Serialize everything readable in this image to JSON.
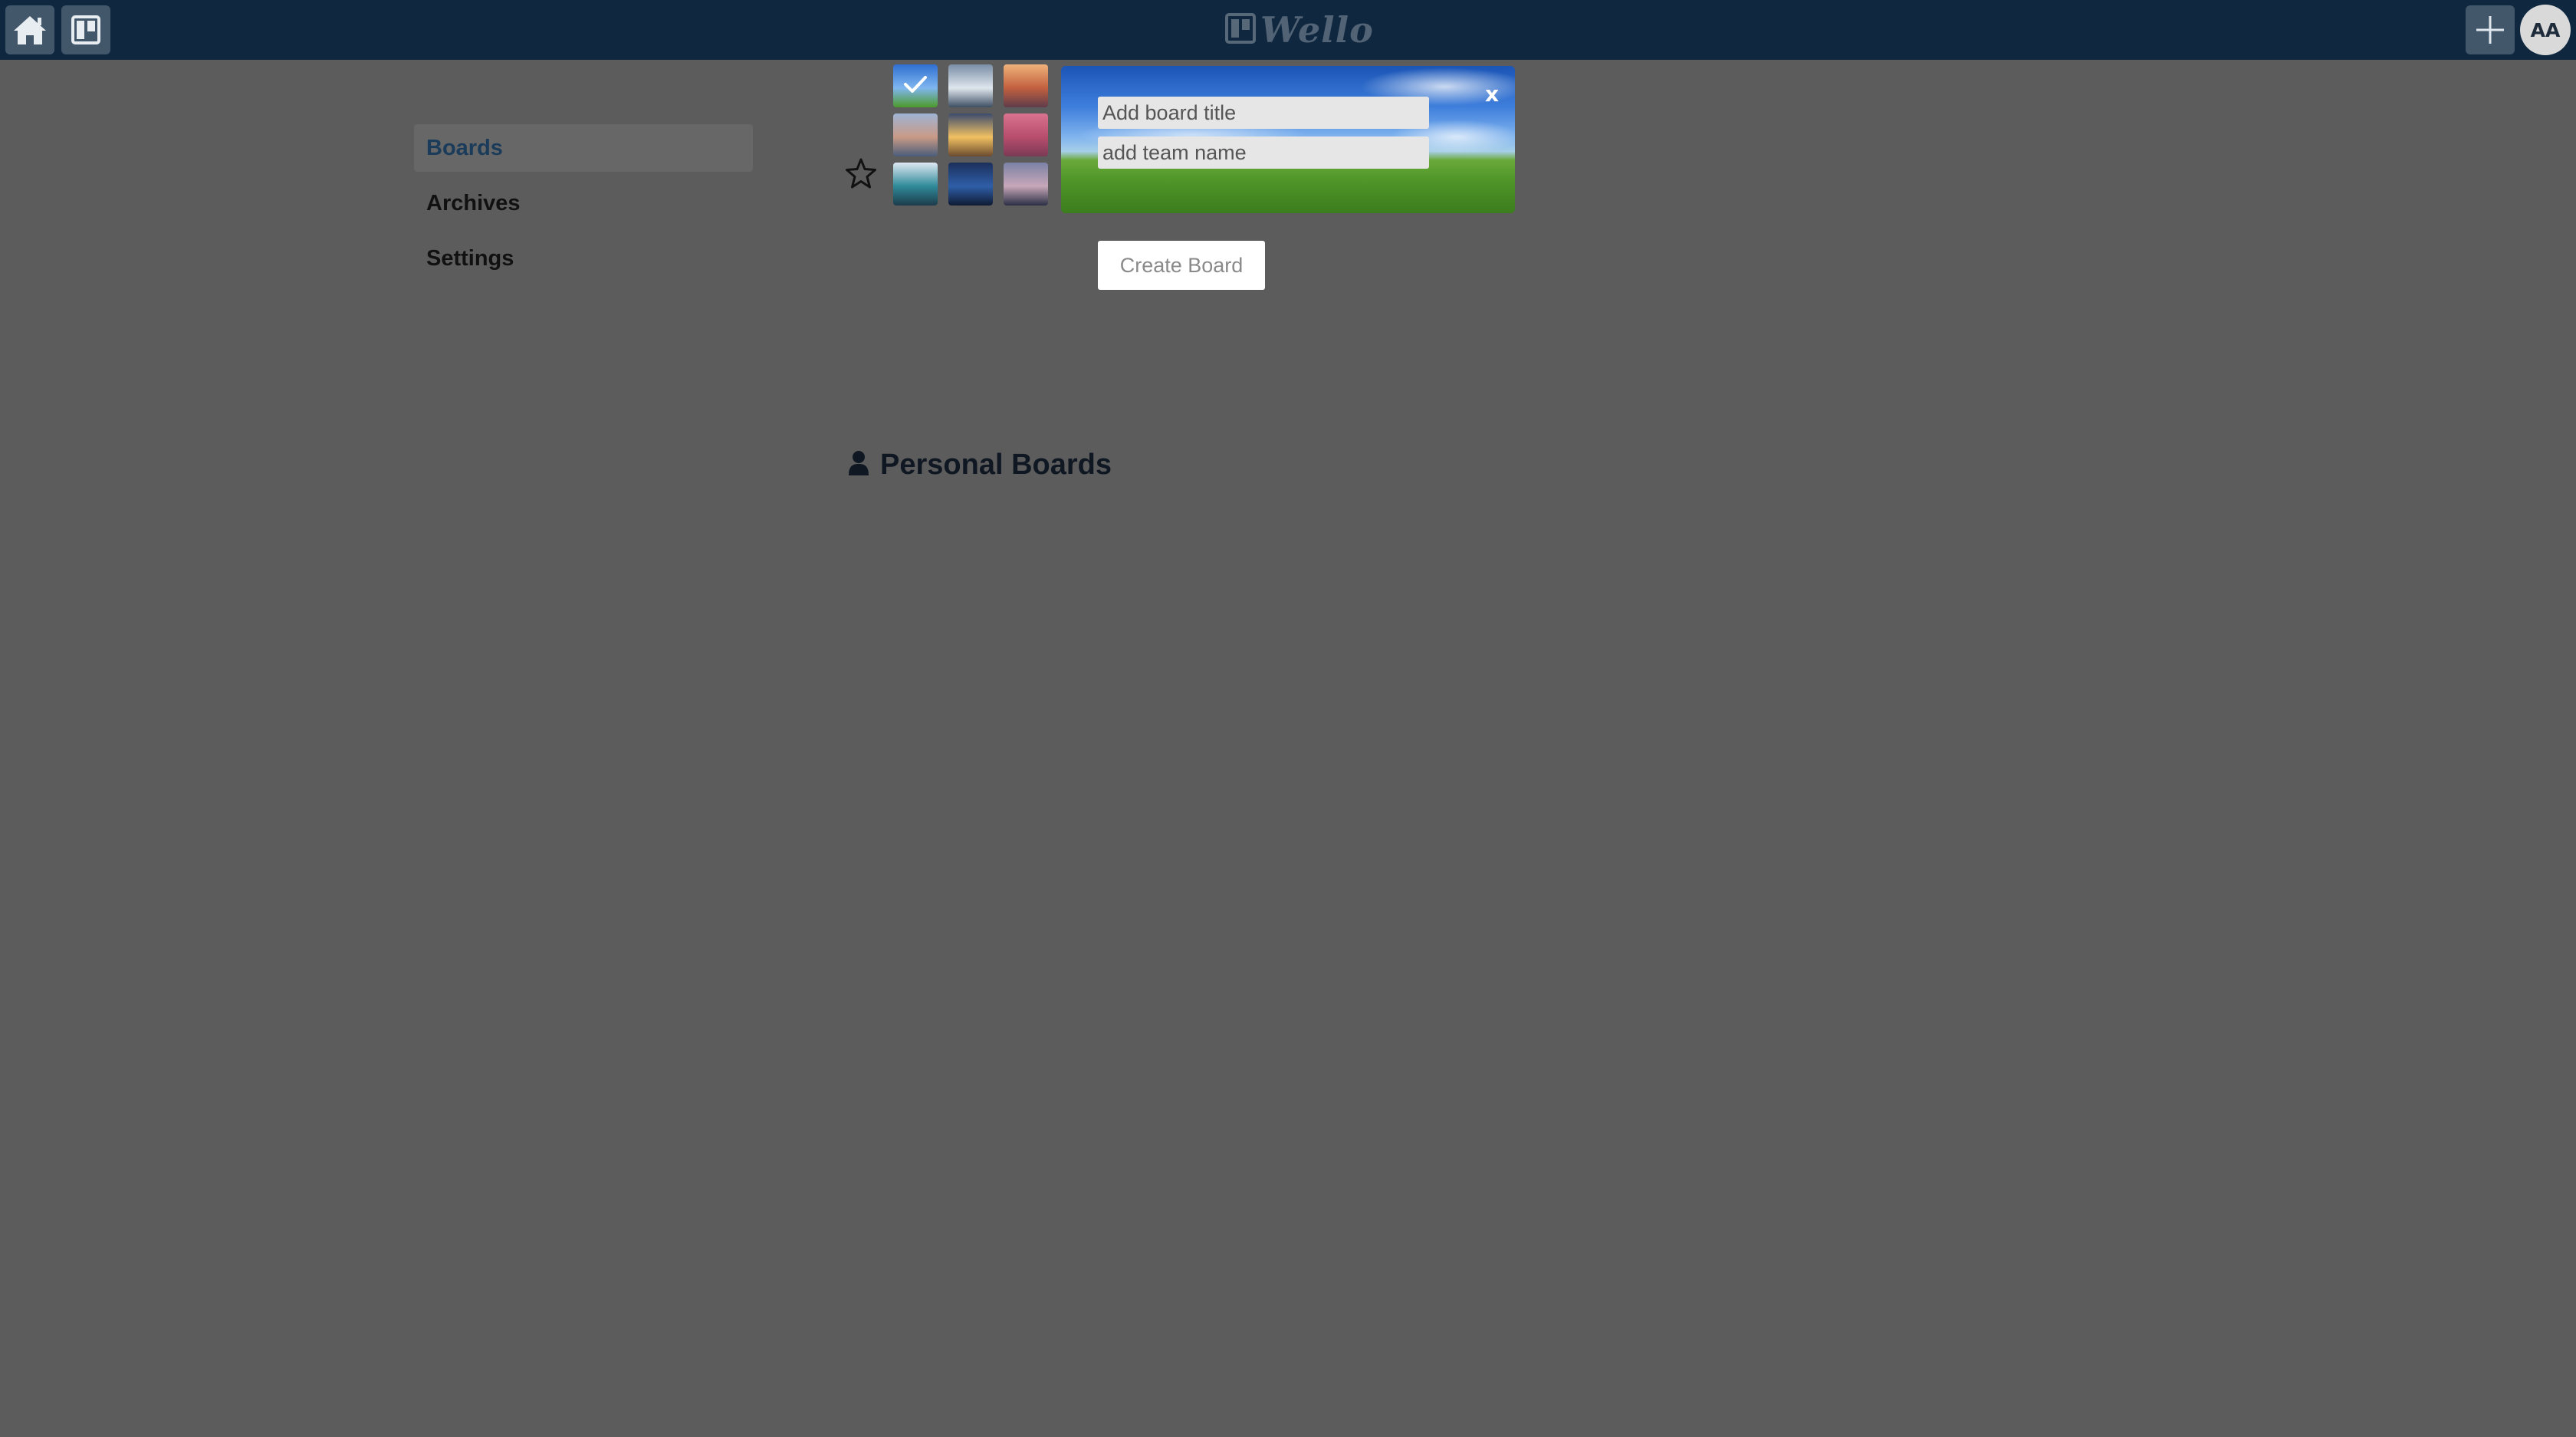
{
  "app": {
    "logo_text": "Wello"
  },
  "topbar": {
    "home_icon": "home-icon",
    "boards_icon": "boards-icon",
    "add_icon": "plus-icon",
    "avatar_initials": "AA"
  },
  "sidebar": {
    "items": [
      {
        "label": "Boards",
        "active": true
      },
      {
        "label": "Archives",
        "active": false
      },
      {
        "label": "Settings",
        "active": false
      }
    ]
  },
  "composer": {
    "title_placeholder": "Add board title",
    "title_value": "",
    "team_placeholder": "add team name",
    "team_value": "",
    "close_label": "x",
    "create_label": "Create Board",
    "star_icon": "star-outline-icon",
    "selected_background": 0,
    "backgrounds": [
      {
        "name": "green-field",
        "colors": [
          "#2f6fd1",
          "#7fb6ef",
          "#4c9a2a"
        ]
      },
      {
        "name": "mountain-lake",
        "colors": [
          "#7a8ea6",
          "#dfe6ee",
          "#3d4e62"
        ]
      },
      {
        "name": "sunset-rocks",
        "colors": [
          "#f0b27a",
          "#c2603f",
          "#5f3c4a"
        ]
      },
      {
        "name": "coastal-town",
        "colors": [
          "#9fb4d4",
          "#c99a86",
          "#4b5d7a"
        ]
      },
      {
        "name": "golden-horizon",
        "colors": [
          "#3b4b6e",
          "#f2c162",
          "#6b4b2f"
        ]
      },
      {
        "name": "pink-blossom",
        "colors": [
          "#d9738f",
          "#b84d6d",
          "#7a3a55"
        ]
      },
      {
        "name": "tropical-bay",
        "colors": [
          "#dfe9f2",
          "#2f8a99",
          "#1d3b4a"
        ]
      },
      {
        "name": "night-city",
        "colors": [
          "#1c2f5b",
          "#2f5ea8",
          "#0f1b33"
        ]
      },
      {
        "name": "dusk-bridge",
        "colors": [
          "#7b82a6",
          "#c7a7b8",
          "#2a2f45"
        ]
      }
    ]
  },
  "personal": {
    "icon": "user-icon",
    "title": "Personal Boards"
  }
}
